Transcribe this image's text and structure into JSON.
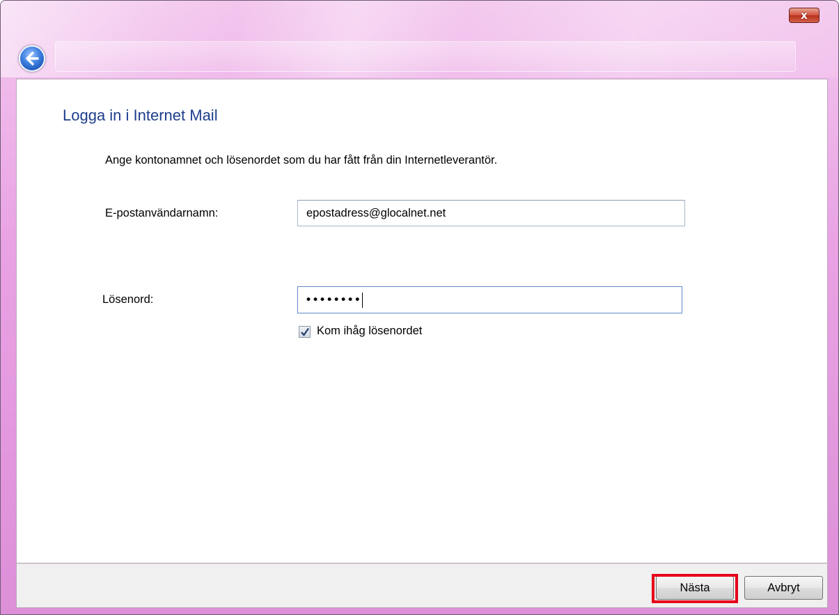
{
  "window": {
    "close_glyph": "x",
    "back_icon": "back-arrow-icon"
  },
  "wizard": {
    "heading": "Logga in i Internet Mail",
    "instructions": "Ange kontonamnet och lösenordet som du har fått från din Internetleverantör."
  },
  "form": {
    "username_label": "E-postanvändarnamn:",
    "username_value": "epostadress@glocalnet.net",
    "password_label": "Lösenord:",
    "password_masked": "••••••••",
    "remember_label": "Kom ihåg lösenordet",
    "remember_checked": true
  },
  "buttons": {
    "next_label": "Nästa",
    "cancel_label": "Avbryt"
  },
  "colors": {
    "heading": "#1e3e8c",
    "highlight": "#e6001b",
    "titlebar": "#e9a2e4"
  }
}
